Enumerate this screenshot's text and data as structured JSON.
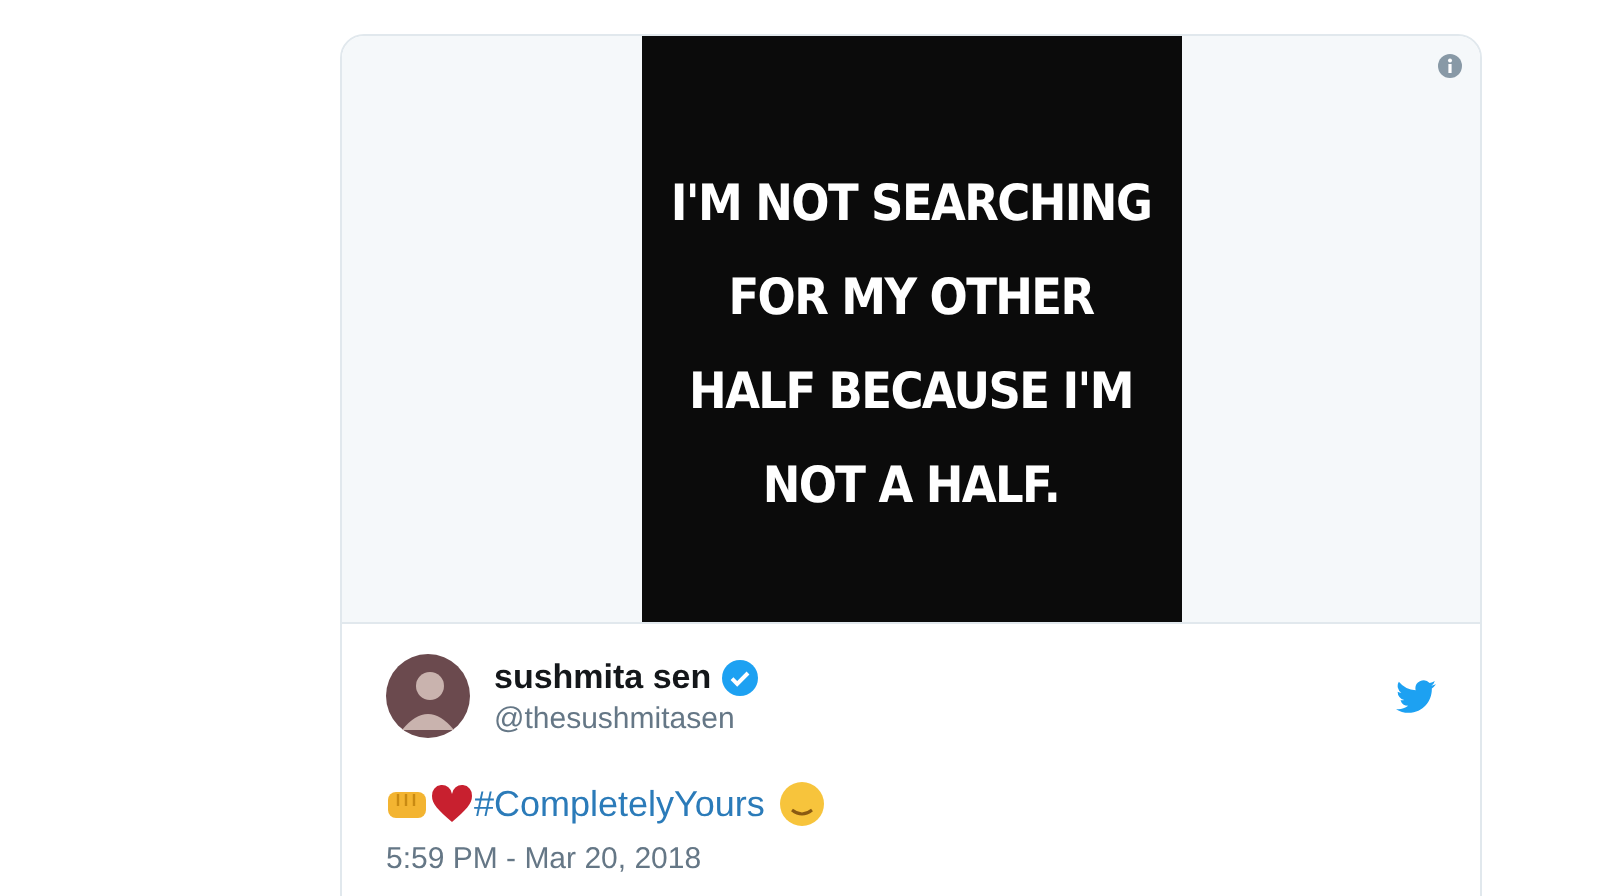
{
  "media": {
    "quote_lines": [
      "I'M NOT SEARCHING",
      "FOR MY OTHER",
      "HALF BECAUSE I'M",
      "NOT A HALF."
    ]
  },
  "author": {
    "name": "sushmita sen",
    "verified": true,
    "handle": "@thesushmitasen"
  },
  "tweet": {
    "hashtag": "#CompletelyYours"
  },
  "timestamp": "5:59 PM - Mar 20, 2018"
}
